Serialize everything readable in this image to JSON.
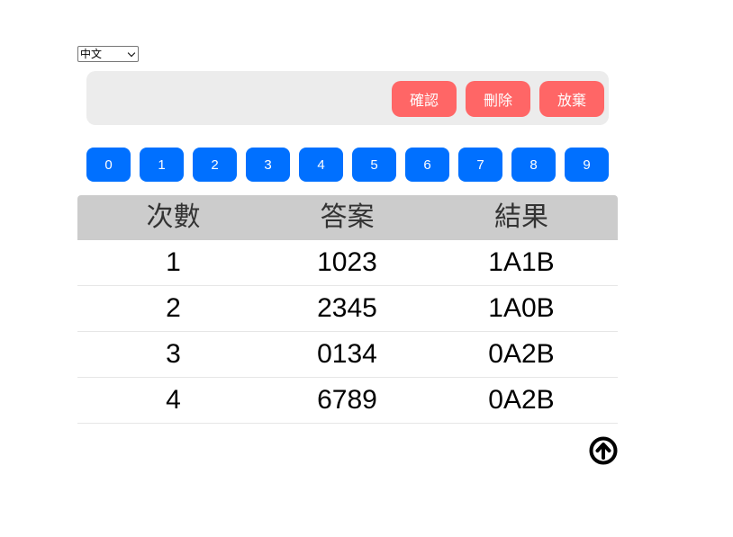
{
  "language_select": {
    "selected": "中文"
  },
  "guess_display": "",
  "actions": {
    "confirm_label": "確認",
    "delete_label": "刪除",
    "giveup_label": "放棄"
  },
  "digits": [
    "0",
    "1",
    "2",
    "3",
    "4",
    "5",
    "6",
    "7",
    "8",
    "9"
  ],
  "table": {
    "headers": [
      "次數",
      "答案",
      "結果"
    ],
    "rows": [
      [
        "1",
        "1023",
        "1A1B"
      ],
      [
        "2",
        "2345",
        "1A0B"
      ],
      [
        "3",
        "0134",
        "0A2B"
      ],
      [
        "4",
        "6789",
        "0A2B"
      ]
    ]
  },
  "colors": {
    "action_button": "#ff6666",
    "digit_button": "#0070ff",
    "header_bg": "#cccccc",
    "input_bar_bg": "#ececec"
  },
  "icons": {
    "scroll_top": "arrow-up-circle-icon"
  }
}
